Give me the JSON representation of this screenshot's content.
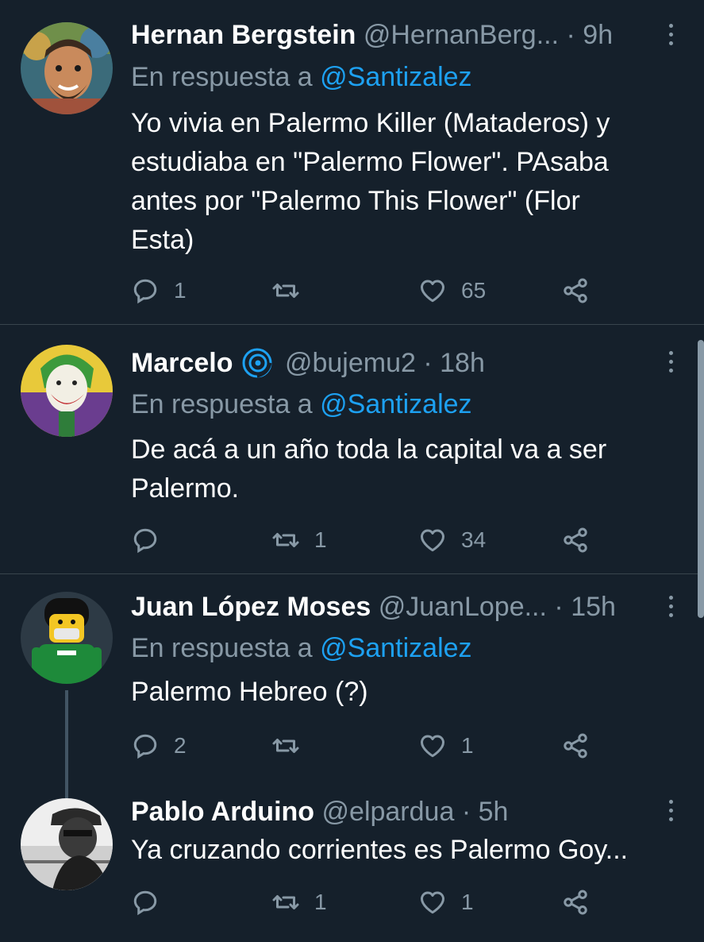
{
  "colors": {
    "background": "#15202b",
    "divider": "#38444d",
    "muted": "#8899a6",
    "link": "#1da1f2",
    "text": "#ffffff"
  },
  "tweets": [
    {
      "name": "Hernan Bergstein",
      "handle": "@HernanBerg...",
      "separator": "·",
      "time": "9h",
      "reply_prefix": "En respuesta a",
      "reply_mention": "@Santizalez",
      "text": "Yo vivia en Palermo  Killer (Mataderos) y\nestudiaba en \"Palermo Flower\". PAsaba\nantes por \"Palermo This Flower\" (Flor\nEsta)",
      "reply_count": "1",
      "retweet_count": "",
      "like_count": "65",
      "avatar_icon": "avatar-painting"
    },
    {
      "name": "Marcelo",
      "verified_icon": "swirl-badge-icon",
      "handle": "@bujemu2",
      "separator": "·",
      "time": "18h",
      "reply_prefix": "En respuesta a",
      "reply_mention": "@Santizalez",
      "text": "De acá a un año toda la capital va a ser\nPalermo.",
      "reply_count": "",
      "retweet_count": "1",
      "like_count": "34",
      "avatar_icon": "avatar-joker"
    },
    {
      "name": "Juan López Moses",
      "handle": "@JuanLope...",
      "separator": "·",
      "time": "15h",
      "reply_prefix": "En respuesta a",
      "reply_mention": "@Santizalez",
      "text": "Palermo Hebreo (?)",
      "reply_count": "2",
      "retweet_count": "",
      "like_count": "1",
      "avatar_icon": "avatar-lego"
    },
    {
      "name": "Pablo Arduino",
      "handle": "@elpardua",
      "separator": "·",
      "time": "5h",
      "text": "Ya cruzando corrientes es Palermo Goy...",
      "reply_count": "",
      "retweet_count": "1",
      "like_count": "1",
      "avatar_icon": "avatar-photo-bw"
    }
  ]
}
